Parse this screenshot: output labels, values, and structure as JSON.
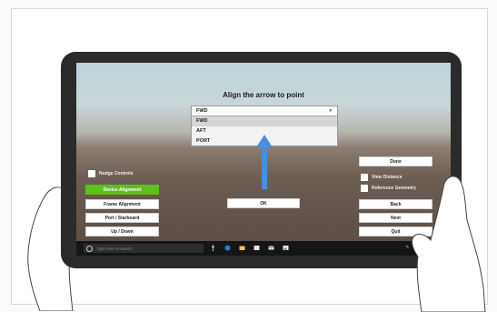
{
  "dialog": {
    "title": "Align the arrow to point",
    "dropdown": {
      "selected": "FWD",
      "options": [
        "FWD",
        "AFT",
        "PORT"
      ]
    },
    "ok_label": "OK"
  },
  "left_panel": {
    "nudge_controls_label": "Nudge Controls",
    "buttons": [
      "Device Alignment",
      "Frame Alignment",
      "Port / Starboard",
      "Up / Down"
    ]
  },
  "right_panel": {
    "done_label": "Done",
    "view_distance_label": "View Distance",
    "reference_geometry_label": "Reference Geometry",
    "buttons": [
      "Back",
      "Next",
      "Quit"
    ]
  },
  "taskbar": {
    "search_placeholder": "Type here to search"
  },
  "colors": {
    "accent_green": "#5ac21b",
    "arrow_blue": "#4a8fdc"
  }
}
